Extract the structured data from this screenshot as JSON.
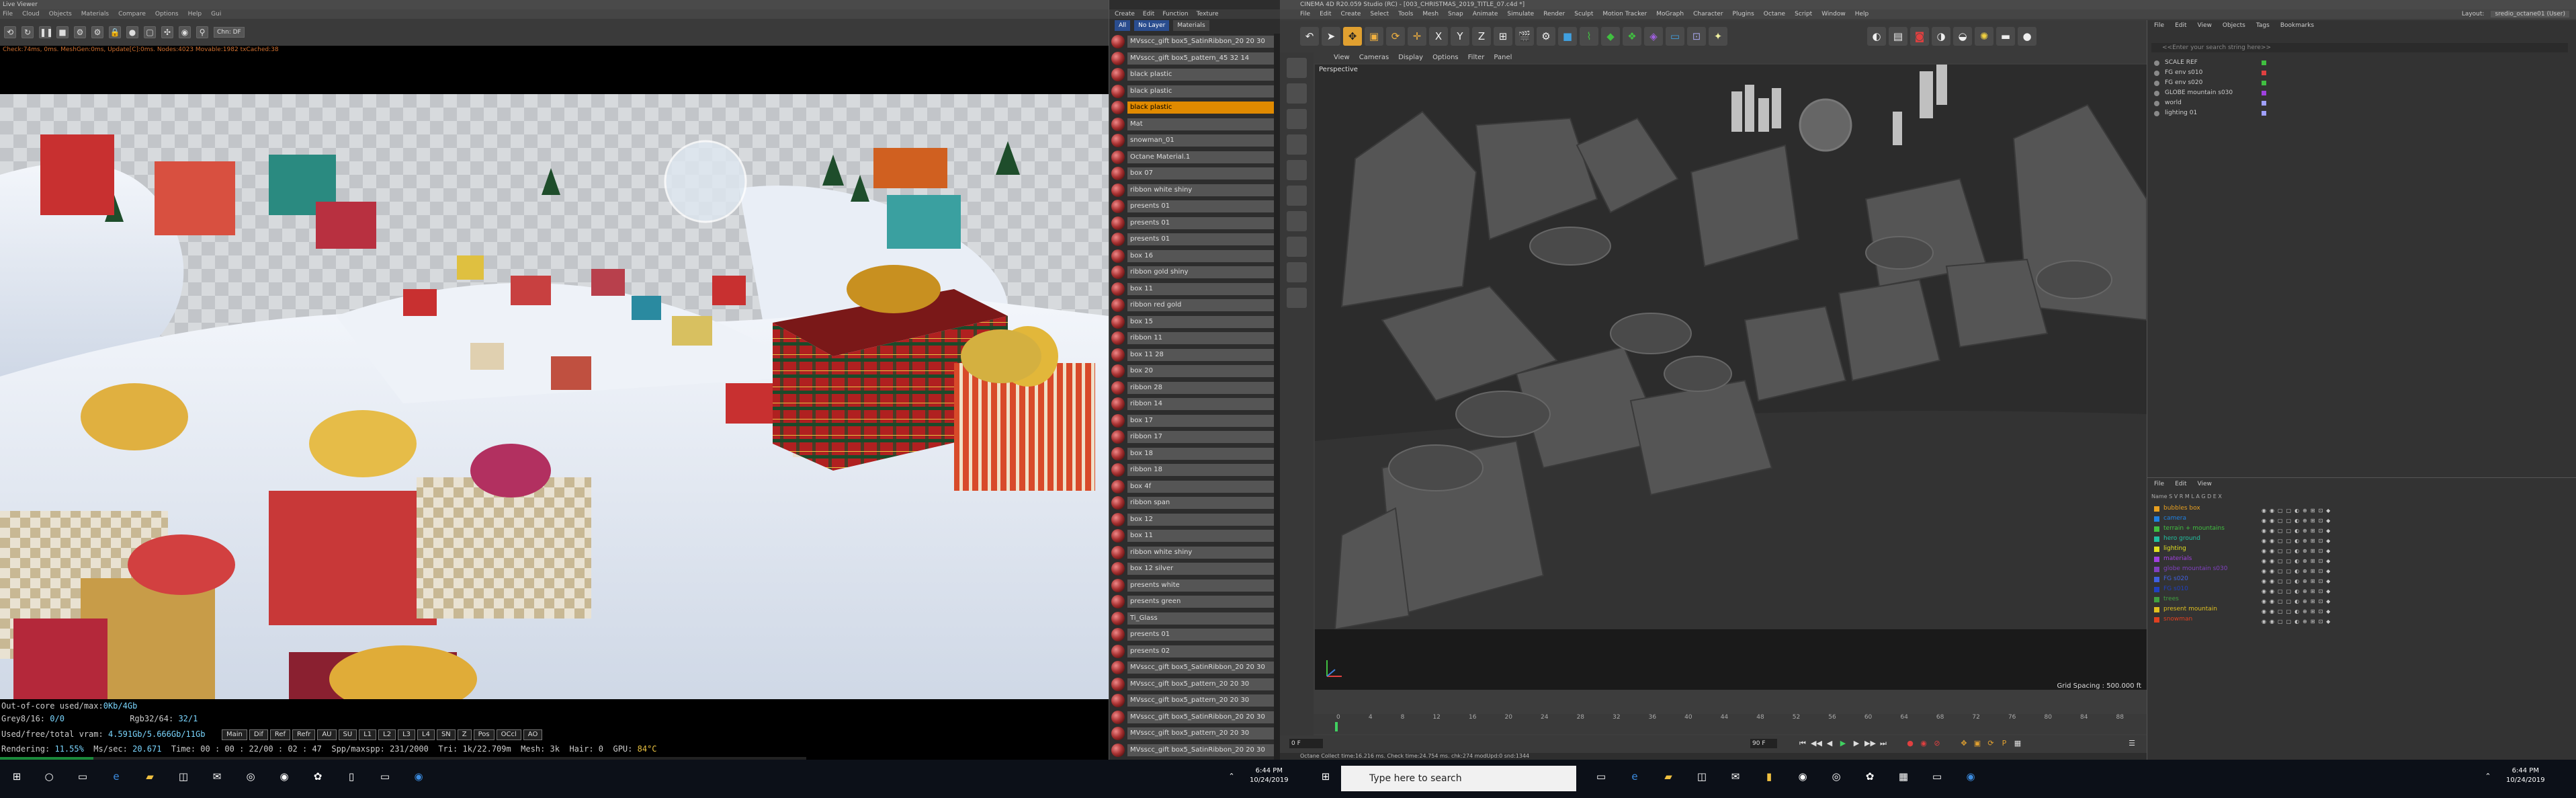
{
  "liveviewer": {
    "title": "Live Viewer",
    "menu": [
      "File",
      "Cloud",
      "Objects",
      "Materials",
      "Compare",
      "Options",
      "Help",
      "Gui"
    ],
    "channel_dropdown": "Chn: DF",
    "status_line": "Check:74ms, 0ms. MeshGen:0ms, Update[C]:0ms. Nodes:4023 Movable:1982 txCached:38",
    "info": {
      "out_of_core_label": "Out-of-core used/max:",
      "out_of_core_value": "0Kb/4Gb",
      "grey_label": "Grey8/16:",
      "grey_value": "0/0",
      "rgb_label": "Rgb32/64:",
      "rgb_value": "32/1",
      "vram_label": "Used/free/total vram:",
      "vram_value": "4.591Gb/5.666Gb/11Gb",
      "buttons": [
        "Main",
        "Dif",
        "Ref",
        "Refr",
        "AU",
        "SU",
        "L1",
        "L2",
        "L3",
        "L4",
        "SN",
        "Z",
        "Pos",
        "OCcl",
        "AO"
      ],
      "rendering_label": "Rendering:",
      "rendering_value": "11.55%",
      "rendering_fraction": 0.1155,
      "mss_label": "Ms/sec:",
      "mss_value": "20.671",
      "time_label": "Time:",
      "time_value": "00 : 00 : 22/00 : 02 : 47",
      "spp_label": "Spp/maxspp:",
      "spp_value": "231/2000",
      "tri_label": "Tri:",
      "tri_value": "1k/22.709m",
      "mesh_label": "Mesh:",
      "mesh_value": "3k",
      "hair_label": "Hair:",
      "hair_value": "0",
      "gpu_label": "GPU:",
      "gpu_value": "84°C"
    }
  },
  "materials": {
    "menu": [
      "Create",
      "Edit",
      "Function",
      "Texture"
    ],
    "tabs": [
      "All",
      "No Layer",
      "Materials"
    ],
    "active_tab": "Materials",
    "items": [
      "MVsscc_gift box5_SatinRibbon_20 20 30",
      "MVsscc_gift box5_pattern_45 32 14",
      "black plastic",
      "black plastic",
      "black plastic",
      "Mat",
      "snowman_01",
      "Octane Material.1",
      "box 07",
      "ribbon white shiny",
      "presents 01",
      "presents 01",
      "presents 01",
      "box 16",
      "ribbon gold shiny",
      "box 11",
      "ribbon red gold",
      "box 15",
      "ribbon 11",
      "box 11 28",
      "box 20",
      "ribbon 28",
      "ribbon 14",
      "box 17",
      "ribbon 17",
      "box 18",
      "ribbon 18",
      "box 4f",
      "ribbon span",
      "box 12",
      "box 11",
      "ribbon white shiny",
      "box 12 silver",
      "presents white",
      "presents green",
      "Ti_Glass",
      "presents 01",
      "presents 02",
      "MVsscc_gift box5_SatinRibbon_20 20 30",
      "MVsscc_gift box5_pattern_20 20 30",
      "MVsscc_gift box5_pattern_20 20 30",
      "MVsscc_gift box5_SatinRibbon_20 20 30",
      "MVsscc_gift box5_pattern_20 20 30",
      "MVsscc_gift box5_SatinRibbon_20 20 30"
    ],
    "selected_index": 4
  },
  "c4d": {
    "title": "CINEMA 4D R20.059 Studio (RC) - [003_CHRISTMAS_2019_TITLE_07.c4d *]",
    "menu": [
      "File",
      "Edit",
      "Create",
      "Select",
      "Tools",
      "Mesh",
      "Snap",
      "Animate",
      "Simulate",
      "Render",
      "Sculpt",
      "Motion Tracker",
      "MoGraph",
      "Character",
      "Plugins",
      "Octane",
      "Script",
      "Window",
      "Help"
    ],
    "layout_label": "Layout:",
    "layout_value": "sredio_octane01 (User)",
    "viewport_menu": [
      "View",
      "Cameras",
      "Display",
      "Options",
      "Filter",
      "Panel"
    ],
    "viewport_label": "Perspective",
    "grid_spacing": "Grid Spacing : 500.000 ft",
    "timeline_ticks": [
      "0",
      "4",
      "8",
      "12",
      "16",
      "20",
      "24",
      "28",
      "32",
      "36",
      "40",
      "44",
      "48",
      "52",
      "56",
      "60",
      "64",
      "68",
      "72",
      "76",
      "80",
      "84",
      "88"
    ],
    "frame_start": "0 F",
    "frame_end": "90 F",
    "status": "Octane Collect time:16.216 ms.  Check time:24.754 ms.  chk:274  modUpd:0  snd:1344",
    "object_manager": {
      "menu": [
        "File",
        "Edit",
        "View",
        "Objects",
        "Tags",
        "Bookmarks"
      ],
      "search_placeholder": "<<Enter your search string here>>",
      "objects": [
        "SCALE REF",
        "FG env s010",
        "FG env s020",
        "GLOBE mountain s030",
        "world",
        "lighting 01"
      ]
    },
    "layers": {
      "menu": [
        "File",
        "Edit",
        "View"
      ],
      "header": "Name                                   S  V  R  M  L  A  G  D  E  X",
      "items": [
        {
          "name": "bubbles box",
          "color": "#e8a020"
        },
        {
          "name": "camera",
          "color": "#2080e0"
        },
        {
          "name": "terrain + mountains",
          "color": "#40c040"
        },
        {
          "name": "hero ground",
          "color": "#20c0a0"
        },
        {
          "name": "lighting",
          "color": "#e0e020"
        },
        {
          "name": "materials",
          "color": "#a040e0"
        },
        {
          "name": "globe mountain s030",
          "color": "#8040c0"
        },
        {
          "name": "FG s020",
          "color": "#4060e0"
        },
        {
          "name": "FG s010",
          "color": "#2040c0"
        },
        {
          "name": "trees",
          "color": "#40a040"
        },
        {
          "name": "present mountain",
          "color": "#e0c020"
        },
        {
          "name": "snowman",
          "color": "#e04020"
        }
      ]
    }
  },
  "taskbar_left": {
    "clock_time": "6:44 PM",
    "clock_date": "10/24/2019"
  },
  "taskbar_right": {
    "search_placeholder": "Type here to search",
    "clock_time": "6:44 PM",
    "clock_date": "10/24/2019"
  }
}
